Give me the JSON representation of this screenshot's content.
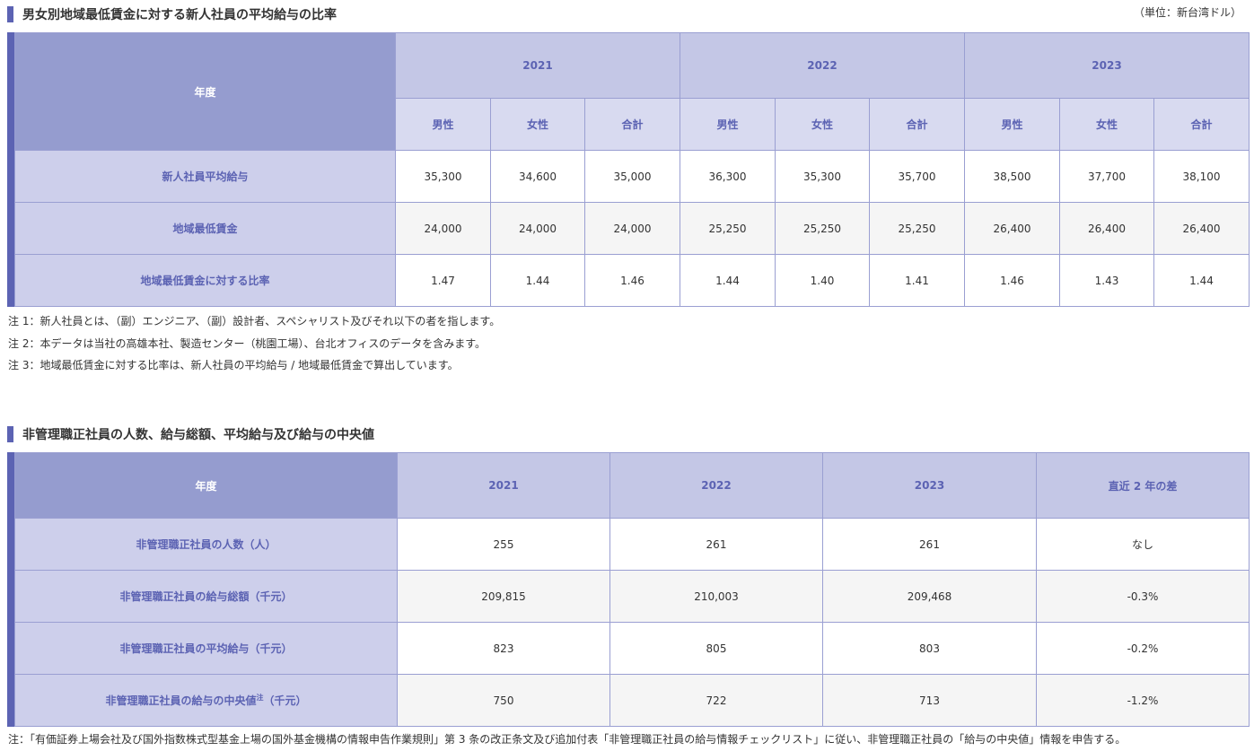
{
  "table1": {
    "title": "男女別地域最低賃金に対する新人社員の平均給与の比率",
    "unit": "（単位：新台湾ドル）",
    "year_header": "年度",
    "years": [
      "2021",
      "2022",
      "2023"
    ],
    "subheaders": [
      "男性",
      "女性",
      "合計"
    ],
    "rows": [
      {
        "label": "新人社員平均給与",
        "values": [
          "35,300",
          "34,600",
          "35,000",
          "36,300",
          "35,300",
          "35,700",
          "38,500",
          "37,700",
          "38,100"
        ]
      },
      {
        "label": "地域最低賃金",
        "values": [
          "24,000",
          "24,000",
          "24,000",
          "25,250",
          "25,250",
          "25,250",
          "26,400",
          "26,400",
          "26,400"
        ]
      },
      {
        "label": "地域最低賃金に対する比率",
        "values": [
          "1.47",
          "1.44",
          "1.46",
          "1.44",
          "1.40",
          "1.41",
          "1.46",
          "1.43",
          "1.44"
        ]
      }
    ],
    "notes": [
      "注 1：新人社員とは、（副）エンジニア、（副）設計者、スペシャリスト及びそれ以下の者を指します。",
      "注 2：本データは当社の高雄本社、製造センター（桃園工場）、台北オフィスのデータを含みます。",
      "注 3：地域最低賃金に対する比率は、新人社員の平均給与 / 地域最低賃金で算出しています。"
    ]
  },
  "table2": {
    "title": "非管理職正社員の人数、給与総額、平均給与及び給与の中央値",
    "year_header": "年度",
    "columns": [
      "2021",
      "2022",
      "2023",
      "直近 2 年の差"
    ],
    "rows": [
      {
        "label": "非管理職正社員の人数（人）",
        "values": [
          "255",
          "261",
          "261",
          "なし"
        ]
      },
      {
        "label": "非管理職正社員の給与総額（千元）",
        "values": [
          "209,815",
          "210,003",
          "209,468",
          "-0.3%"
        ]
      },
      {
        "label": "非管理職正社員の平均給与（千元）",
        "values": [
          "823",
          "805",
          "803",
          "-0.2%"
        ]
      },
      {
        "label_main": "非管理職正社員の給与の中央値",
        "label_sup": "注",
        "label_unit": "（千元）",
        "values": [
          "750",
          "722",
          "713",
          "-1.2%"
        ]
      }
    ],
    "note": "注：「有価証券上場会社及び国外指数株式型基金上場の国外基金機構の情報申告作業規則」第 3 条の改正条文及び追加付表「非管理職正社員の給与情報チェックリスト」に従い、非管理職正社員の「給与の中央値」情報を申告する。"
  }
}
